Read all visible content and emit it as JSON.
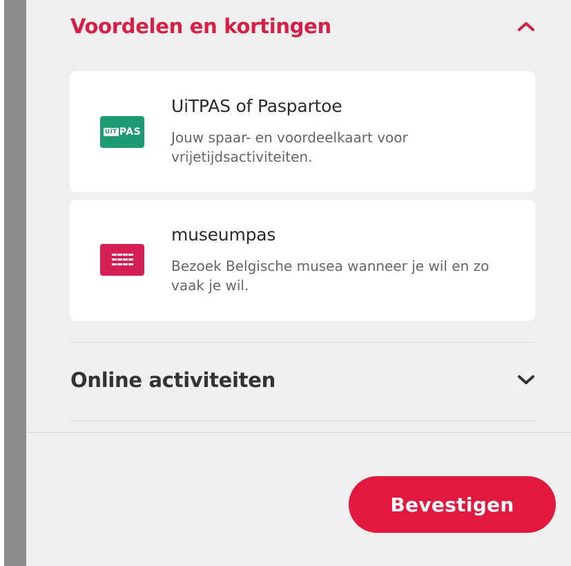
{
  "sections": {
    "benefits": {
      "title": "Voordelen en kortingen",
      "expanded": true,
      "icon": "chevron-up-icon",
      "cards": [
        {
          "title": "UiTPAS of Paspartoe",
          "description": "Jouw spaar- en voordeelkaart voor vrijetijdsactiviteiten.",
          "logo": "uitpas-logo",
          "logo_text_box": "UiT",
          "logo_text": "PAS",
          "logo_color": "#1d9c74"
        },
        {
          "title": "museumpas",
          "description": "Bezoek Belgische musea wanneer je wil en zo vaak je wil.",
          "logo": "museumpas-logo",
          "logo_color": "#d61f55"
        }
      ]
    },
    "online": {
      "title": "Online activiteiten",
      "expanded": false,
      "icon": "chevron-down-icon"
    }
  },
  "footer": {
    "confirm_label": "Bevestigen"
  },
  "colors": {
    "accent": "#e3183f",
    "accent_text": "#d71f45",
    "panel_bg": "#efefef",
    "card_bg": "#ffffff"
  }
}
